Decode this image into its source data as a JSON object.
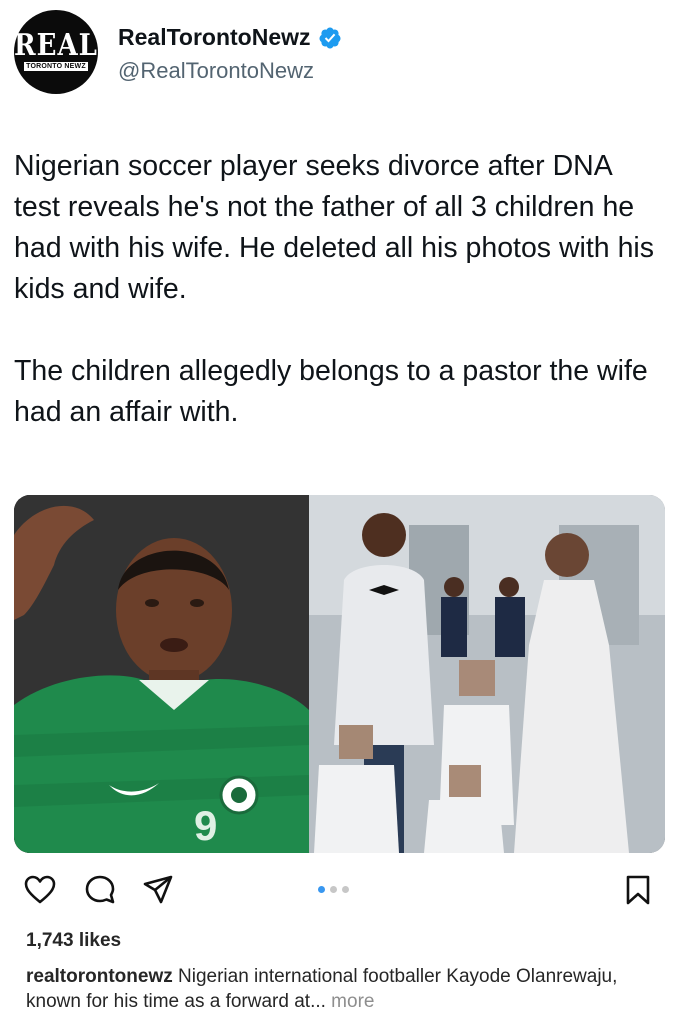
{
  "account": {
    "logo_text": "REAL",
    "logo_subtext": "TORONTO NEWZ",
    "display_name": "RealTorontoNewz",
    "handle": "@RealTorontoNewz",
    "verified_icon": "verified-badge-icon",
    "verified_color": "#1d9bf0"
  },
  "tweet": {
    "paragraph1": "Nigerian soccer player seeks divorce after DNA test reveals he's not the father of all 3 children he had with his wife. He deleted all his photos with his kids and wife.",
    "paragraph2": "The children allegedly belongs to a pastor the wife had an affair with."
  },
  "media": {
    "left_photo_icon": "soccer-player-photo",
    "left_jersey_number": "9",
    "right_photo_icon": "family-wedding-photo"
  },
  "actions": {
    "like_icon": "heart-icon",
    "comment_icon": "comment-icon",
    "share_icon": "send-icon",
    "save_icon": "bookmark-icon",
    "carousel_dots": 3,
    "carousel_active": 1
  },
  "post": {
    "likes": "1,743 likes",
    "caption_user": "realtorontonewz",
    "caption_text": " Nigerian international footballer Kayode Olanrewaju, known for his time as a forward at...",
    "more_label": " more"
  }
}
